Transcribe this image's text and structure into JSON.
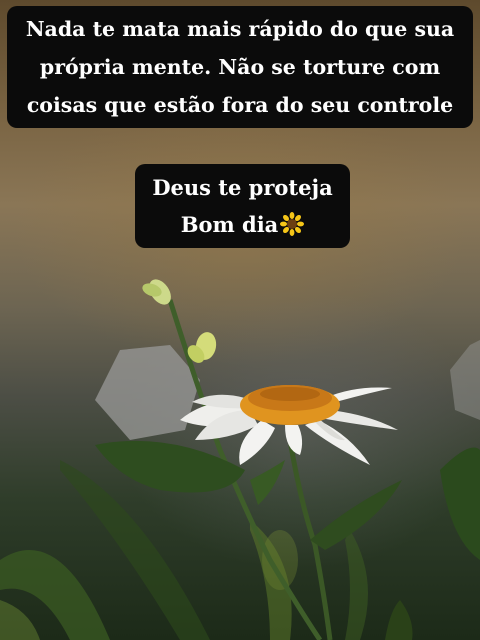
{
  "overlay_text": {
    "top_lines": [
      "Nada te mata mais rápido do que sua",
      "própria mente. Não se torture com",
      "coisas que estão fora do seu controle"
    ],
    "middle_lines": [
      "Deus te proteja",
      "Bom dia"
    ],
    "middle_emoji": "sunflower-icon"
  },
  "photo": {
    "subject": "white-daisy-flower-with-buds-and-grass",
    "colors": {
      "petals": "#f3f3f1",
      "center": "#e0941f",
      "stem": "#3f5e2a",
      "caption_bg": "#0b0b0b",
      "caption_text": "#ffffff"
    }
  }
}
